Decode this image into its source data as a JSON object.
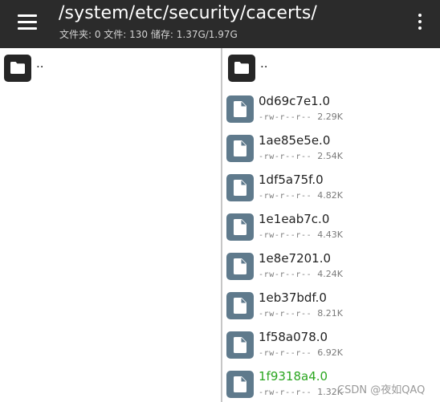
{
  "toolbar": {
    "menu_icon": "menu-icon",
    "path": "/system/etc/security/cacerts/",
    "stats": "文件夹: 0  文件: 130  储存: 1.37G/1.97G",
    "more_icon": "more-vert-icon",
    "background": "#2b2b2b"
  },
  "left_pane": {
    "parent_label": ".."
  },
  "right_pane": {
    "parent_label": "..",
    "files": [
      {
        "name": "0d69c7e1.0",
        "perm": "-rw-r--r--",
        "size": "2.29K"
      },
      {
        "name": "1ae85e5e.0",
        "perm": "-rw-r--r--",
        "size": "2.54K"
      },
      {
        "name": "1df5a75f.0",
        "perm": "-rw-r--r--",
        "size": "4.82K"
      },
      {
        "name": "1e1eab7c.0",
        "perm": "-rw-r--r--",
        "size": "4.43K"
      },
      {
        "name": "1e8e7201.0",
        "perm": "-rw-r--r--",
        "size": "4.24K"
      },
      {
        "name": "1eb37bdf.0",
        "perm": "-rw-r--r--",
        "size": "8.21K"
      },
      {
        "name": "1f58a078.0",
        "perm": "-rw-r--r--",
        "size": "6.92K"
      },
      {
        "name": "1f9318a4.0",
        "perm": "-rw-r--r--",
        "size": "1.32K",
        "highlighted": true
      }
    ]
  },
  "colors": {
    "folder_tile": "#262626",
    "file_tile": "#5f7a8c",
    "highlight_text": "#2aa61f"
  },
  "watermark": "CSDN @夜如QAQ"
}
